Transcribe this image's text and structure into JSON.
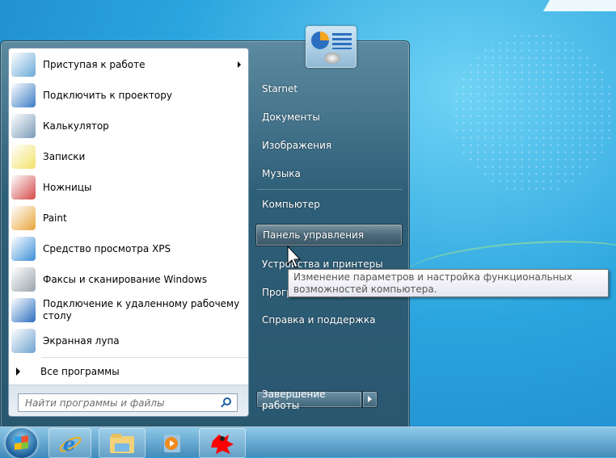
{
  "start_menu": {
    "pinned_programs": [
      {
        "label": "Приступая к работе",
        "icon": "getting-started-icon",
        "color": "#6aa9d8",
        "submenu": true
      },
      {
        "label": "Подключить к проектору",
        "icon": "projector-icon",
        "color": "#3a7cc4"
      },
      {
        "label": "Калькулятор",
        "icon": "calculator-icon",
        "color": "#7a9bb8"
      },
      {
        "label": "Записки",
        "icon": "sticky-notes-icon",
        "color": "#f2e26a"
      },
      {
        "label": "Ножницы",
        "icon": "scissors-icon",
        "color": "#d44a4a"
      },
      {
        "label": "Paint",
        "icon": "paint-icon",
        "color": "#e8a53a"
      },
      {
        "label": "Средство просмотра XPS",
        "icon": "xps-viewer-icon",
        "color": "#3a8ed8"
      },
      {
        "label": "Факсы и сканирование Windows",
        "icon": "fax-scan-icon",
        "color": "#9aa4ad"
      },
      {
        "label": "Подключение к удаленному рабочему столу",
        "icon": "remote-desktop-icon",
        "color": "#2c6fc1"
      },
      {
        "label": "Экранная лупа",
        "icon": "magnifier-icon",
        "color": "#6fa3cf"
      }
    ],
    "all_programs_label": "Все программы",
    "search_placeholder": "Найти программы и файлы",
    "right_items": [
      "Starnet",
      "Документы",
      "Изображения",
      "Музыка",
      "Компьютер",
      "Панель управления",
      "Устройства и принтеры",
      "Программы по умолчанию",
      "Справка и поддержка"
    ],
    "highlighted_item": "Панель управления",
    "shutdown_label": "Завершение работы"
  },
  "tooltip": "Изменение параметров и настройка функциональных возможностей компьютера.",
  "taskbar": {
    "items": [
      "internet-explorer-icon",
      "windows-explorer-icon",
      "media-player-icon",
      "app-red-splat-icon"
    ]
  }
}
